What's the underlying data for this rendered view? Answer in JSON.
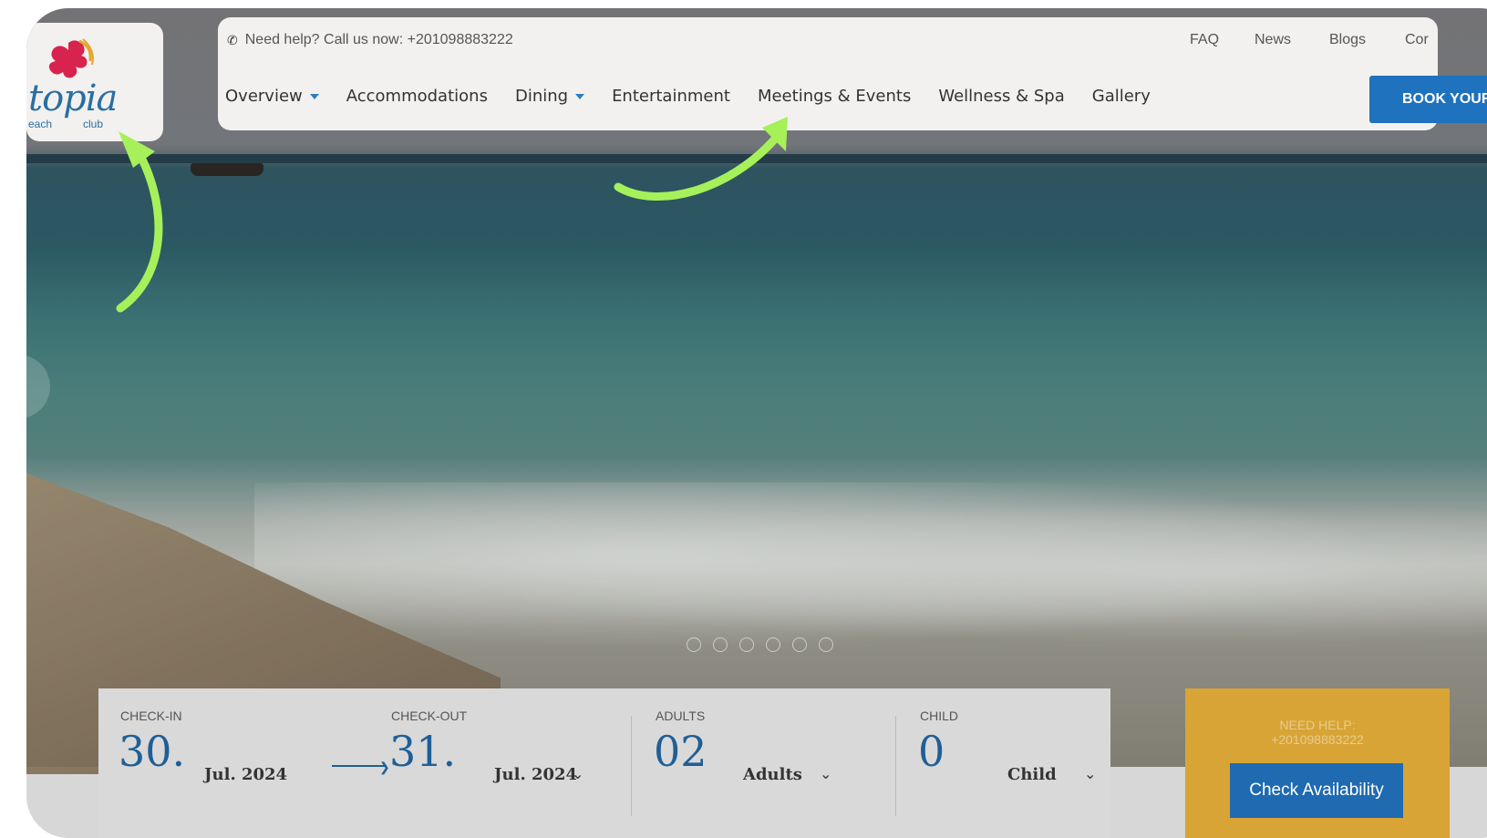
{
  "header": {
    "help_text": "Need help? Call us now: +201098883222",
    "top_links": [
      "FAQ",
      "News",
      "Blogs",
      "Cor"
    ],
    "menu": [
      {
        "label": "Overview",
        "has_caret": true
      },
      {
        "label": "Accommodations",
        "has_caret": false
      },
      {
        "label": "Dining",
        "has_caret": true
      },
      {
        "label": "Entertainment",
        "has_caret": false
      },
      {
        "label": "Meetings & Events",
        "has_caret": false
      },
      {
        "label": "Wellness & Spa",
        "has_caret": false
      },
      {
        "label": "Gallery",
        "has_caret": false
      }
    ],
    "book_button": "BOOK YOUR ST"
  },
  "logo": {
    "text": "topia",
    "sub_left": "each",
    "sub_right": "club"
  },
  "slider": {
    "dot_count": 6
  },
  "booking": {
    "checkin_label": "CHECK-IN",
    "checkin_day": "30.",
    "checkin_month": "Jul. 2024",
    "checkout_label": "CHECK-OUT",
    "checkout_day": "31.",
    "checkout_month": "Jul. 2024",
    "adults_label": "ADULTS",
    "adults_value": "02",
    "adults_text": "Adults",
    "child_label": "CHILD",
    "child_value": "0",
    "child_text": "Child",
    "help_line1": "NEED HELP:",
    "help_line2": "+201098883222",
    "check_button": "Check Availability"
  },
  "colors": {
    "brand_blue": "#1f72bd",
    "accent_gold": "#d8a436",
    "annotation_green": "#a6f05a"
  }
}
